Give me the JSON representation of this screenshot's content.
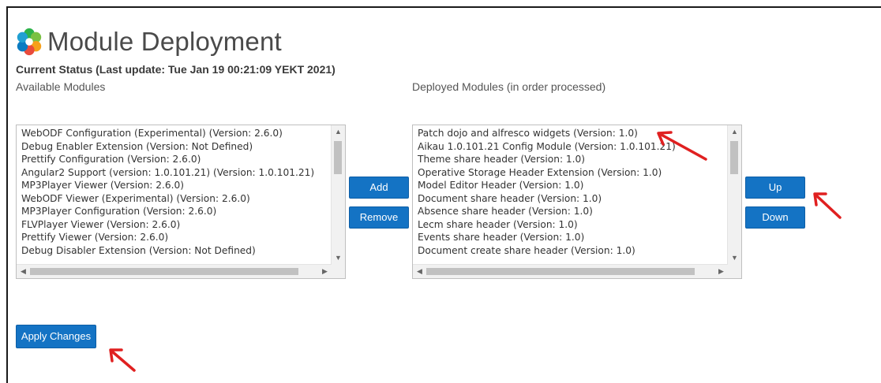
{
  "header": {
    "title": "Module Deployment",
    "status": "Current Status (Last update: Tue Jan 19 00:21:09 YEKT 2021)",
    "logo_icon": "alfresco-flower-icon"
  },
  "available": {
    "label": "Available Modules",
    "items": [
      "WebODF Configuration (Experimental) (Version: 2.6.0)",
      "Debug Enabler Extension (Version: Not Defined)",
      "Prettify Configuration (Version: 2.6.0)",
      "Angular2 Support (version: 1.0.101.21) (Version: 1.0.101.21)",
      "MP3Player Viewer (Version: 2.6.0)",
      "WebODF Viewer (Experimental) (Version: 2.6.0)",
      "MP3Player Configuration (Version: 2.6.0)",
      "FLVPlayer Viewer (Version: 2.6.0)",
      "Prettify Viewer (Version: 2.6.0)",
      "Debug Disabler Extension (Version: Not Defined)"
    ]
  },
  "deployed": {
    "label": "Deployed Modules (in order processed)",
    "items": [
      "Patch dojo and alfresco widgets (Version: 1.0)",
      "Aikau 1.0.101.21 Config Module (Version: 1.0.101.21)",
      "Theme share header (Version: 1.0)",
      "Operative Storage Header Extension (Version: 1.0)",
      "Model Editor Header (Version: 1.0)",
      "Document share header (Version: 1.0)",
      "Absence share header (Version: 1.0)",
      "Lecm share header (Version: 1.0)",
      "Events share header (Version: 1.0)",
      "Document create share header (Version: 1.0)"
    ]
  },
  "buttons": {
    "add": "Add",
    "remove": "Remove",
    "up": "Up",
    "down": "Down",
    "apply": "Apply Changes"
  },
  "colors": {
    "button": "#1473c4",
    "annotation_arrow": "#e02020"
  }
}
